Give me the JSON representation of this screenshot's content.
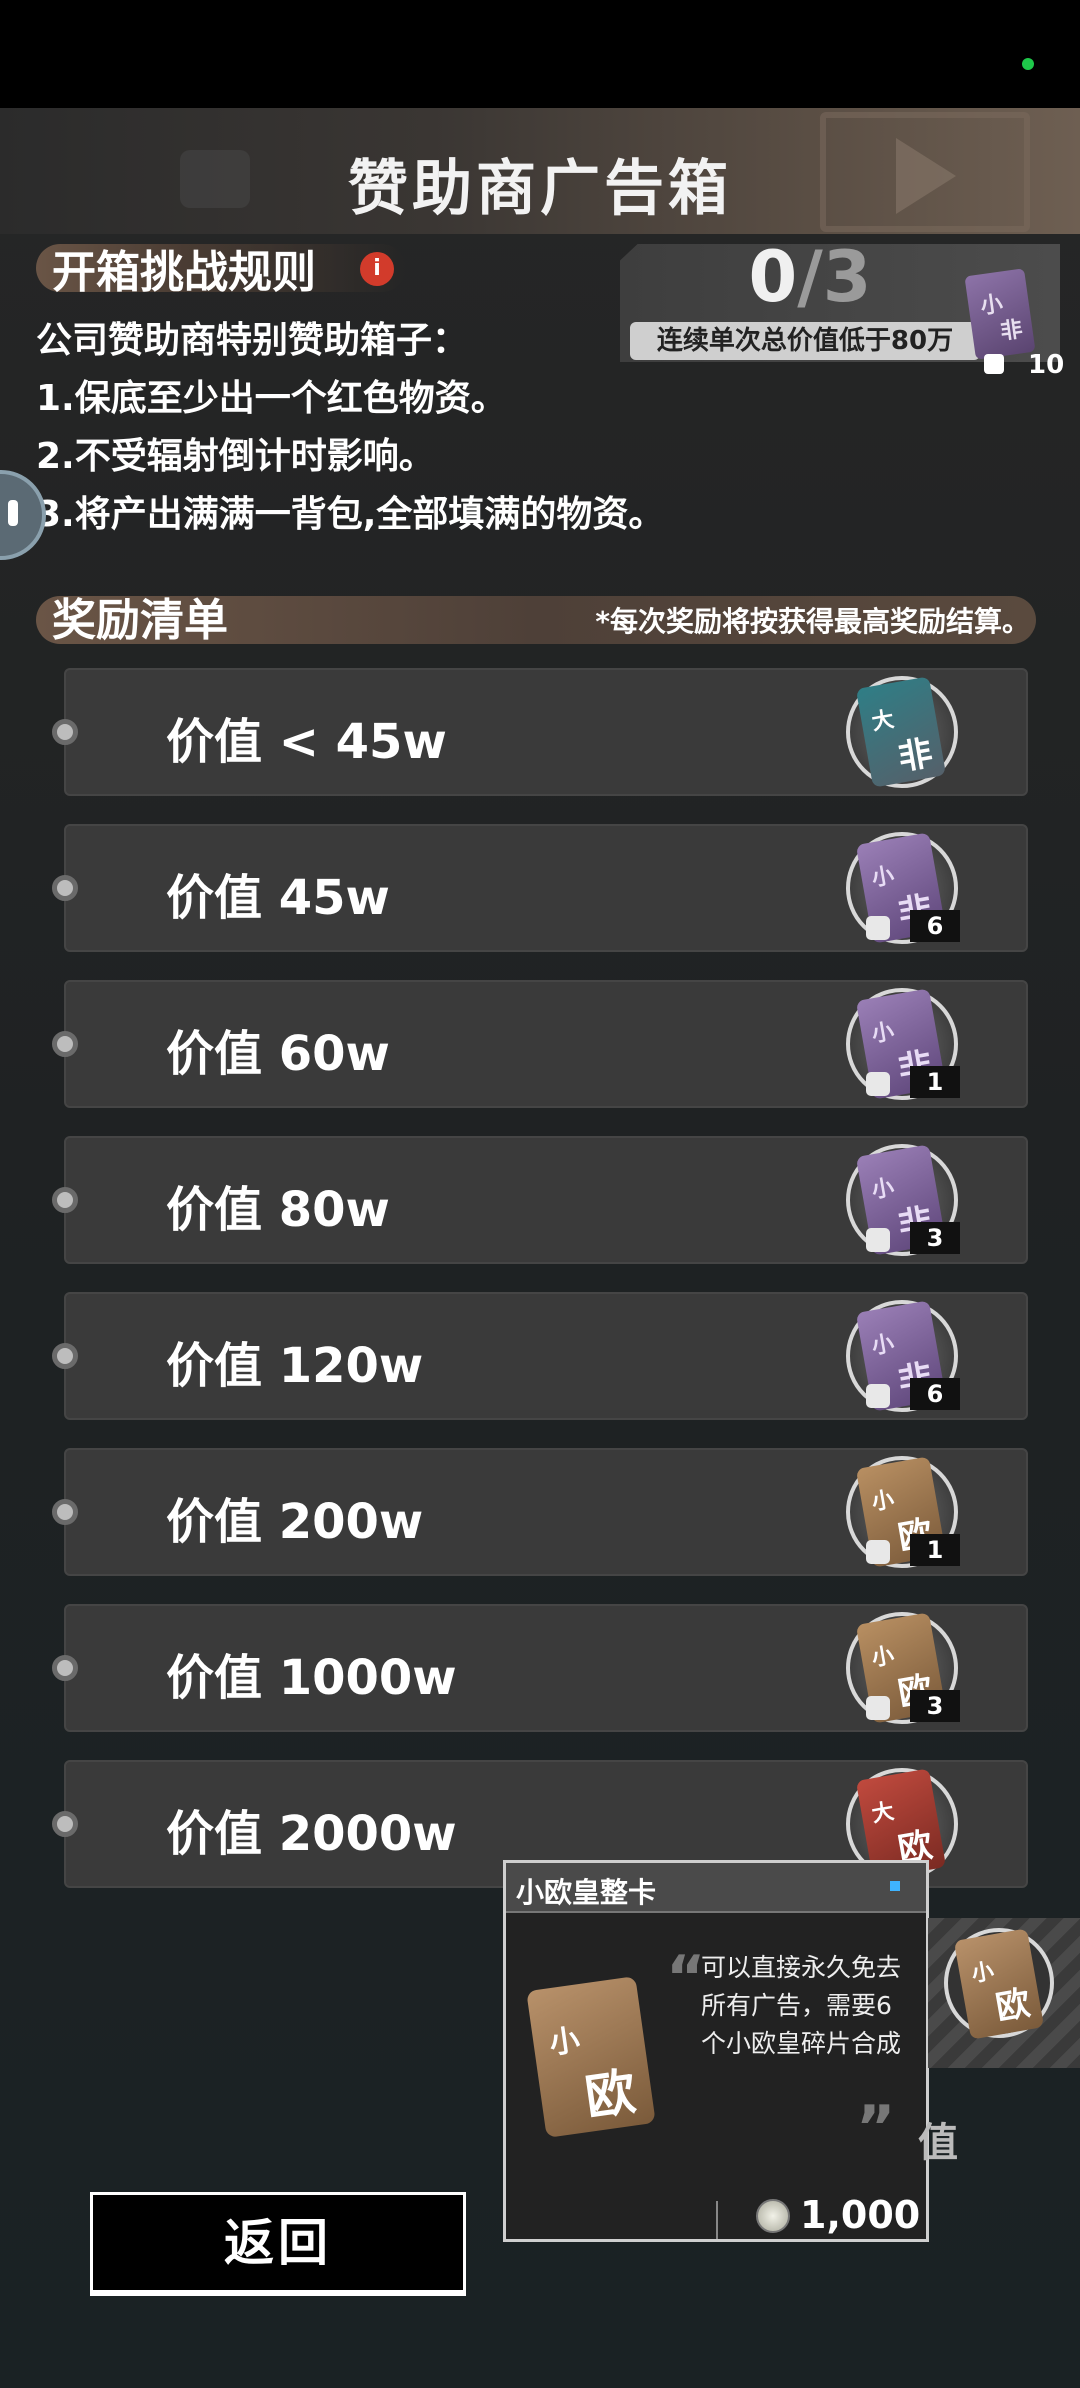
{
  "window": {
    "title": "赞助商广告箱"
  },
  "rules": {
    "title": "开箱挑战规则",
    "info_icon": "info-icon",
    "lines": [
      "公司赞助商特别赞助箱子：",
      "1.保底至少出一个红色物资。",
      "2.不受辐射倒计时影响。",
      "3.将产出满满一背包,全部填满的物资。"
    ]
  },
  "progress": {
    "current": "0",
    "total": "/3",
    "label": "连续单次总价值低于80万",
    "card_top": "小",
    "card_bottom": "非",
    "pieces": "10"
  },
  "rewards": {
    "title": "奖励清单",
    "note": "*每次奖励将按获得最高奖励结算。",
    "items": [
      {
        "label": "价值 < 45w",
        "card": "teal",
        "top": "大",
        "bottom": "非",
        "count": ""
      },
      {
        "label": "价值 45w",
        "card": "purple",
        "top": "小",
        "bottom": "非",
        "count": "6"
      },
      {
        "label": "价值 60w",
        "card": "purple",
        "top": "小",
        "bottom": "非",
        "count": "1"
      },
      {
        "label": "价值 80w",
        "card": "purple",
        "top": "小",
        "bottom": "非",
        "count": "3"
      },
      {
        "label": "价值 120w",
        "card": "purple",
        "top": "小",
        "bottom": "非",
        "count": "6"
      },
      {
        "label": "价值 200w",
        "card": "brown",
        "top": "小",
        "bottom": "欧",
        "count": "1"
      },
      {
        "label": "价值 1000w",
        "card": "brown",
        "top": "小",
        "bottom": "欧",
        "count": "3"
      },
      {
        "label": "价值 2000w",
        "card": "red",
        "top": "大",
        "bottom": "欧",
        "count": ""
      }
    ]
  },
  "tooltip": {
    "title": "小欧皇整卡",
    "desc": "可以直接永久免去所有广告，需要6个小欧皇碎片合成",
    "price": "1,000",
    "card_top": "小",
    "card_bottom": "欧"
  },
  "claim": {
    "card_top": "小",
    "card_bottom": "欧",
    "partial_text": "值"
  },
  "footer": {
    "back_label": "返回"
  },
  "colors": {
    "accent_red": "#d23b2b",
    "status_green": "#1ec84a",
    "pin_blue": "#3fb4ff"
  }
}
